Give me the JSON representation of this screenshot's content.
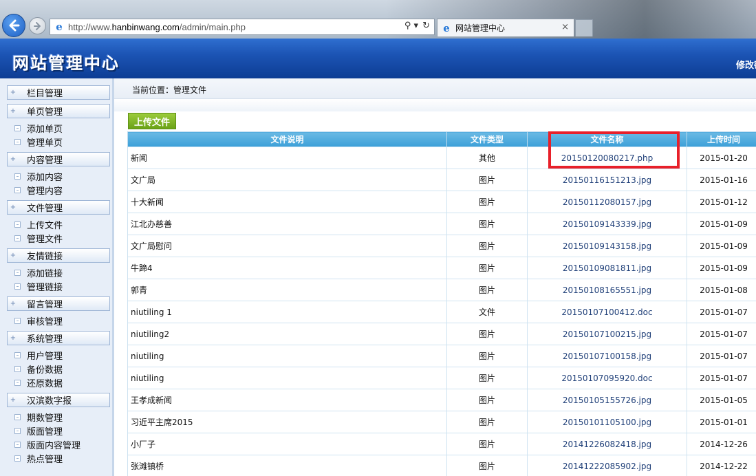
{
  "browser": {
    "url_prefix": "http://www.",
    "url_host": "hanbinwang.com",
    "url_path": "/admin/main.php",
    "tab_title": "网站管理中心",
    "tab_close": "×",
    "search_glyph": "⚲ ▾",
    "refresh_glyph": "↻"
  },
  "header": {
    "title": "网站管理中心",
    "right_link": "修改密码"
  },
  "sidebar": {
    "groups": [
      {
        "label": "栏目管理",
        "items": []
      },
      {
        "label": "单页管理",
        "items": [
          "添加单页",
          "管理单页"
        ]
      },
      {
        "label": "内容管理",
        "items": [
          "添加内容",
          "管理内容"
        ]
      },
      {
        "label": "文件管理",
        "items": [
          "上传文件",
          "管理文件"
        ]
      },
      {
        "label": "友情链接",
        "items": [
          "添加链接",
          "管理链接"
        ]
      },
      {
        "label": "留言管理",
        "items": [
          "审核管理"
        ]
      },
      {
        "label": "系统管理",
        "items": [
          "用户管理",
          "备份数据",
          "还原数据"
        ]
      },
      {
        "label": "汉滨数字报",
        "items": [
          "期数管理",
          "版面管理",
          "版面内容管理",
          "热点管理"
        ]
      }
    ]
  },
  "main": {
    "breadcrumb_label": "当前位置：",
    "breadcrumb_value": "管理文件",
    "upload_button": "上传文件",
    "columns": [
      "文件说明",
      "文件类型",
      "文件名称",
      "上传时间"
    ],
    "rows": [
      [
        "新闻",
        "其他",
        "20150120080217.php",
        "2015-01-20"
      ],
      [
        "文广局",
        "图片",
        "20150116151213.jpg",
        "2015-01-16"
      ],
      [
        "十大新闻",
        "图片",
        "20150112080157.jpg",
        "2015-01-12"
      ],
      [
        "江北办慈善",
        "图片",
        "20150109143339.jpg",
        "2015-01-09"
      ],
      [
        "文广局慰问",
        "图片",
        "20150109143158.jpg",
        "2015-01-09"
      ],
      [
        "牛蹄4",
        "图片",
        "20150109081811.jpg",
        "2015-01-09"
      ],
      [
        "郭青",
        "图片",
        "20150108165551.jpg",
        "2015-01-08"
      ],
      [
        "niutiling 1",
        "文件",
        "20150107100412.doc",
        "2015-01-07"
      ],
      [
        "niutiling2",
        "图片",
        "20150107100215.jpg",
        "2015-01-07"
      ],
      [
        "niutiling",
        "图片",
        "20150107100158.jpg",
        "2015-01-07"
      ],
      [
        "niutiling",
        "图片",
        "20150107095920.doc",
        "2015-01-07"
      ],
      [
        "王孝成新闻",
        "图片",
        "20150105155726.jpg",
        "2015-01-05"
      ],
      [
        "习近平主席2015",
        "图片",
        "20150101105100.jpg",
        "2015-01-01"
      ],
      [
        "小厂子",
        "图片",
        "20141226082418.jpg",
        "2014-12-26"
      ],
      [
        "张滩镇桥",
        "图片",
        "20141222085902.jpg",
        "2014-12-22"
      ]
    ]
  },
  "colors": {
    "header_blue": "#1c54b4",
    "table_header": "#3ca0d8",
    "upload_green": "#7ab024",
    "highlight_red": "#e8202a"
  }
}
